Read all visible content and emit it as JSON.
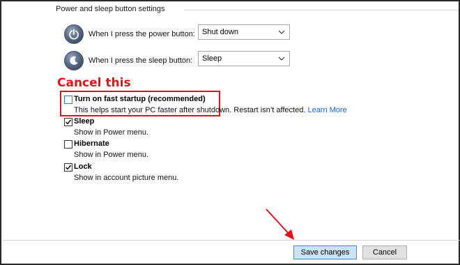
{
  "section": {
    "title": "Power and sleep button settings"
  },
  "power_row": {
    "label": "When I press the power button:",
    "value": "Shut down"
  },
  "sleep_row": {
    "label": "When I press the sleep button:",
    "value": "Sleep"
  },
  "annotation": {
    "text": "Cancel this",
    "color": "#e0121b"
  },
  "options": [
    {
      "title": "Turn on fast startup (recommended)",
      "desc": "This helps start your PC faster after shutdown. Restart isn’t affected.",
      "link": "Learn More",
      "checked": false
    },
    {
      "title": "Sleep",
      "desc": "Show in Power menu.",
      "checked": true
    },
    {
      "title": "Hibernate",
      "desc": "Show in Power menu.",
      "checked": false
    },
    {
      "title": "Lock",
      "desc": "Show in account picture menu.",
      "checked": true
    }
  ],
  "footer": {
    "save_label": "Save changes",
    "cancel_label": "Cancel"
  },
  "icons": {
    "power": "power-icon",
    "sleep": "moon-icon",
    "dropdown": "chevron-down-icon",
    "check": "checkmark-icon"
  }
}
